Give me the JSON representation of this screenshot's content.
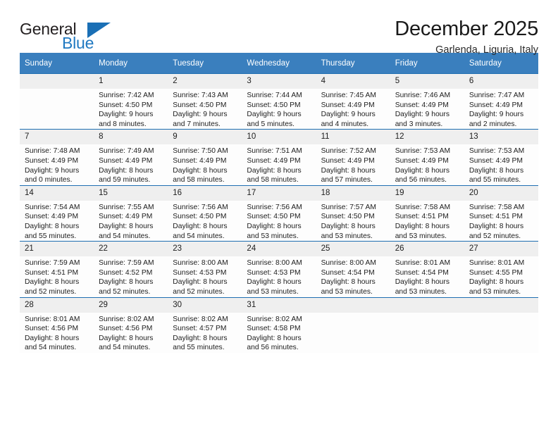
{
  "logo": {
    "word_top": "General",
    "word_bottom": "Blue",
    "triangle": "blue-triangle-icon",
    "accent_color": "#2079c1"
  },
  "header": {
    "title": "December 2025",
    "subtitle": "Garlenda, Liguria, Italy",
    "header_bg": "#3a7fbe",
    "row_rule_color": "#1f6fb2"
  },
  "weekdays": [
    "Sunday",
    "Monday",
    "Tuesday",
    "Wednesday",
    "Thursday",
    "Friday",
    "Saturday"
  ],
  "weeks": [
    [
      {
        "day": "",
        "l1": "",
        "l2": "",
        "l3": "",
        "l4": ""
      },
      {
        "day": "1",
        "l1": "Sunrise: 7:42 AM",
        "l2": "Sunset: 4:50 PM",
        "l3": "Daylight: 9 hours",
        "l4": "and 8 minutes."
      },
      {
        "day": "2",
        "l1": "Sunrise: 7:43 AM",
        "l2": "Sunset: 4:50 PM",
        "l3": "Daylight: 9 hours",
        "l4": "and 7 minutes."
      },
      {
        "day": "3",
        "l1": "Sunrise: 7:44 AM",
        "l2": "Sunset: 4:50 PM",
        "l3": "Daylight: 9 hours",
        "l4": "and 5 minutes."
      },
      {
        "day": "4",
        "l1": "Sunrise: 7:45 AM",
        "l2": "Sunset: 4:49 PM",
        "l3": "Daylight: 9 hours",
        "l4": "and 4 minutes."
      },
      {
        "day": "5",
        "l1": "Sunrise: 7:46 AM",
        "l2": "Sunset: 4:49 PM",
        "l3": "Daylight: 9 hours",
        "l4": "and 3 minutes."
      },
      {
        "day": "6",
        "l1": "Sunrise: 7:47 AM",
        "l2": "Sunset: 4:49 PM",
        "l3": "Daylight: 9 hours",
        "l4": "and 2 minutes."
      }
    ],
    [
      {
        "day": "7",
        "l1": "Sunrise: 7:48 AM",
        "l2": "Sunset: 4:49 PM",
        "l3": "Daylight: 9 hours",
        "l4": "and 0 minutes."
      },
      {
        "day": "8",
        "l1": "Sunrise: 7:49 AM",
        "l2": "Sunset: 4:49 PM",
        "l3": "Daylight: 8 hours",
        "l4": "and 59 minutes."
      },
      {
        "day": "9",
        "l1": "Sunrise: 7:50 AM",
        "l2": "Sunset: 4:49 PM",
        "l3": "Daylight: 8 hours",
        "l4": "and 58 minutes."
      },
      {
        "day": "10",
        "l1": "Sunrise: 7:51 AM",
        "l2": "Sunset: 4:49 PM",
        "l3": "Daylight: 8 hours",
        "l4": "and 58 minutes."
      },
      {
        "day": "11",
        "l1": "Sunrise: 7:52 AM",
        "l2": "Sunset: 4:49 PM",
        "l3": "Daylight: 8 hours",
        "l4": "and 57 minutes."
      },
      {
        "day": "12",
        "l1": "Sunrise: 7:53 AM",
        "l2": "Sunset: 4:49 PM",
        "l3": "Daylight: 8 hours",
        "l4": "and 56 minutes."
      },
      {
        "day": "13",
        "l1": "Sunrise: 7:53 AM",
        "l2": "Sunset: 4:49 PM",
        "l3": "Daylight: 8 hours",
        "l4": "and 55 minutes."
      }
    ],
    [
      {
        "day": "14",
        "l1": "Sunrise: 7:54 AM",
        "l2": "Sunset: 4:49 PM",
        "l3": "Daylight: 8 hours",
        "l4": "and 55 minutes."
      },
      {
        "day": "15",
        "l1": "Sunrise: 7:55 AM",
        "l2": "Sunset: 4:49 PM",
        "l3": "Daylight: 8 hours",
        "l4": "and 54 minutes."
      },
      {
        "day": "16",
        "l1": "Sunrise: 7:56 AM",
        "l2": "Sunset: 4:50 PM",
        "l3": "Daylight: 8 hours",
        "l4": "and 54 minutes."
      },
      {
        "day": "17",
        "l1": "Sunrise: 7:56 AM",
        "l2": "Sunset: 4:50 PM",
        "l3": "Daylight: 8 hours",
        "l4": "and 53 minutes."
      },
      {
        "day": "18",
        "l1": "Sunrise: 7:57 AM",
        "l2": "Sunset: 4:50 PM",
        "l3": "Daylight: 8 hours",
        "l4": "and 53 minutes."
      },
      {
        "day": "19",
        "l1": "Sunrise: 7:58 AM",
        "l2": "Sunset: 4:51 PM",
        "l3": "Daylight: 8 hours",
        "l4": "and 53 minutes."
      },
      {
        "day": "20",
        "l1": "Sunrise: 7:58 AM",
        "l2": "Sunset: 4:51 PM",
        "l3": "Daylight: 8 hours",
        "l4": "and 52 minutes."
      }
    ],
    [
      {
        "day": "21",
        "l1": "Sunrise: 7:59 AM",
        "l2": "Sunset: 4:51 PM",
        "l3": "Daylight: 8 hours",
        "l4": "and 52 minutes."
      },
      {
        "day": "22",
        "l1": "Sunrise: 7:59 AM",
        "l2": "Sunset: 4:52 PM",
        "l3": "Daylight: 8 hours",
        "l4": "and 52 minutes."
      },
      {
        "day": "23",
        "l1": "Sunrise: 8:00 AM",
        "l2": "Sunset: 4:53 PM",
        "l3": "Daylight: 8 hours",
        "l4": "and 52 minutes."
      },
      {
        "day": "24",
        "l1": "Sunrise: 8:00 AM",
        "l2": "Sunset: 4:53 PM",
        "l3": "Daylight: 8 hours",
        "l4": "and 53 minutes."
      },
      {
        "day": "25",
        "l1": "Sunrise: 8:00 AM",
        "l2": "Sunset: 4:54 PM",
        "l3": "Daylight: 8 hours",
        "l4": "and 53 minutes."
      },
      {
        "day": "26",
        "l1": "Sunrise: 8:01 AM",
        "l2": "Sunset: 4:54 PM",
        "l3": "Daylight: 8 hours",
        "l4": "and 53 minutes."
      },
      {
        "day": "27",
        "l1": "Sunrise: 8:01 AM",
        "l2": "Sunset: 4:55 PM",
        "l3": "Daylight: 8 hours",
        "l4": "and 53 minutes."
      }
    ],
    [
      {
        "day": "28",
        "l1": "Sunrise: 8:01 AM",
        "l2": "Sunset: 4:56 PM",
        "l3": "Daylight: 8 hours",
        "l4": "and 54 minutes."
      },
      {
        "day": "29",
        "l1": "Sunrise: 8:02 AM",
        "l2": "Sunset: 4:56 PM",
        "l3": "Daylight: 8 hours",
        "l4": "and 54 minutes."
      },
      {
        "day": "30",
        "l1": "Sunrise: 8:02 AM",
        "l2": "Sunset: 4:57 PM",
        "l3": "Daylight: 8 hours",
        "l4": "and 55 minutes."
      },
      {
        "day": "31",
        "l1": "Sunrise: 8:02 AM",
        "l2": "Sunset: 4:58 PM",
        "l3": "Daylight: 8 hours",
        "l4": "and 56 minutes."
      },
      {
        "day": "",
        "l1": "",
        "l2": "",
        "l3": "",
        "l4": ""
      },
      {
        "day": "",
        "l1": "",
        "l2": "",
        "l3": "",
        "l4": ""
      },
      {
        "day": "",
        "l1": "",
        "l2": "",
        "l3": "",
        "l4": ""
      }
    ]
  ]
}
